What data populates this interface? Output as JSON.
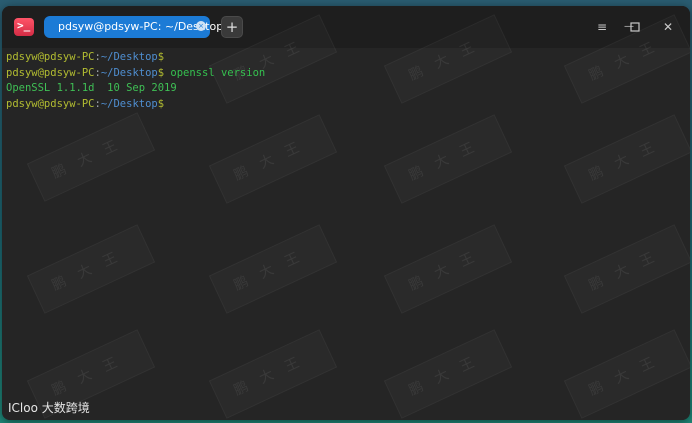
{
  "titlebar": {
    "app_icon_glyph": ">_",
    "tab_title": "pdsyw@pdsyw-PC: ~/Desktop",
    "tab_close_glyph": "×",
    "new_tab_glyph": "+",
    "menu_glyph": "≡",
    "minimize_glyph": "—",
    "maximize_glyph": "☐",
    "close_glyph": "✕"
  },
  "terminal": {
    "lines": [
      {
        "user": "pdsyw@pdsyw-PC",
        "sep": ":",
        "path": "~/Desktop",
        "dollar": "$",
        "cmd": ""
      },
      {
        "user": "pdsyw@pdsyw-PC",
        "sep": ":",
        "path": "~/Desktop",
        "dollar": "$",
        "cmd": " openssl version"
      },
      {
        "output": "OpenSSL 1.1.1d  10 Sep 2019"
      },
      {
        "user": "pdsyw@pdsyw-PC",
        "sep": ":",
        "path": "~/Desktop",
        "dollar": "$",
        "cmd": ""
      }
    ]
  },
  "watermark": {
    "text": "鹏大王"
  },
  "corner_logo": {
    "text": "ICloo 大数跨境"
  },
  "colors": {
    "prompt_user": "#b2bc31",
    "prompt_path": "#4f8ed0",
    "command": "#35c04f",
    "tab_active": "#1c7bd6",
    "app_icon": "#e53a52"
  }
}
